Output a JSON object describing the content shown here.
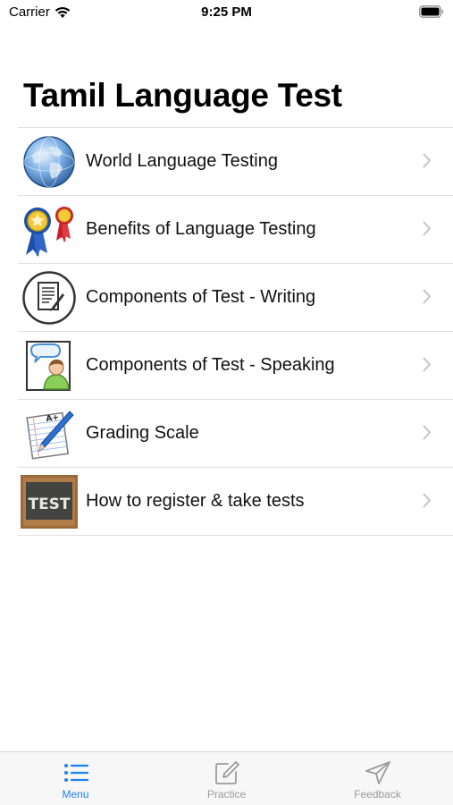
{
  "status_bar": {
    "carrier": "Carrier",
    "time": "9:25 PM"
  },
  "title": "Tamil Language Test",
  "menu": {
    "items": [
      {
        "label": "World Language Testing",
        "icon": "globe-icon"
      },
      {
        "label": "Benefits of Language Testing",
        "icon": "award-ribbons-icon"
      },
      {
        "label": "Components of Test - Writing",
        "icon": "writing-document-icon"
      },
      {
        "label": "Components of Test - Speaking",
        "icon": "speaking-person-icon"
      },
      {
        "label": "Grading Scale",
        "icon": "graded-paper-icon"
      },
      {
        "label": "How to register & take tests",
        "icon": "test-chalkboard-icon"
      }
    ]
  },
  "tab_bar": {
    "tabs": [
      {
        "label": "Menu",
        "icon": "list-icon",
        "active": true
      },
      {
        "label": "Practice",
        "icon": "compose-icon",
        "active": false
      },
      {
        "label": "Feedback",
        "icon": "paper-plane-icon",
        "active": false
      }
    ]
  },
  "colors": {
    "accent": "#1a82f7",
    "inactive": "#9b9b9b",
    "separator": "#e0e0e0",
    "chevron": "#c4c4c7"
  },
  "chalkboard_text": "TEST",
  "grade_mark": "A+"
}
